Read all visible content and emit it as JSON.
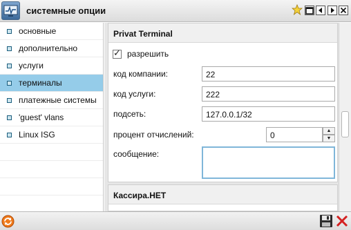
{
  "window": {
    "title": "системные опции"
  },
  "nav": {
    "items": [
      {
        "label": "основные"
      },
      {
        "label": "дополнительно"
      },
      {
        "label": "услуги"
      },
      {
        "label": "терминалы"
      },
      {
        "label": "платежные системы"
      },
      {
        "label": "'guest' vlans"
      },
      {
        "label": "Linux ISG"
      }
    ],
    "selected_index": 3
  },
  "terminal": {
    "heading": "Privat Terminal",
    "enable_label": "разрешить",
    "enabled": true,
    "company_code_label": "код компании:",
    "company_code_value": "22",
    "service_code_label": "код услуги:",
    "service_code_value": "222",
    "subnet_label": "подсеть:",
    "subnet_value": "127.0.0.1/32",
    "percent_label": "процент отчислений:",
    "percent_value": "0",
    "message_label": "сообщение:",
    "message_value": ""
  },
  "next_section": {
    "heading": "Кассира.НЕТ"
  },
  "colors": {
    "selected": "#95cce9",
    "accent": "#d42020",
    "focus": "#7fb6d9"
  }
}
